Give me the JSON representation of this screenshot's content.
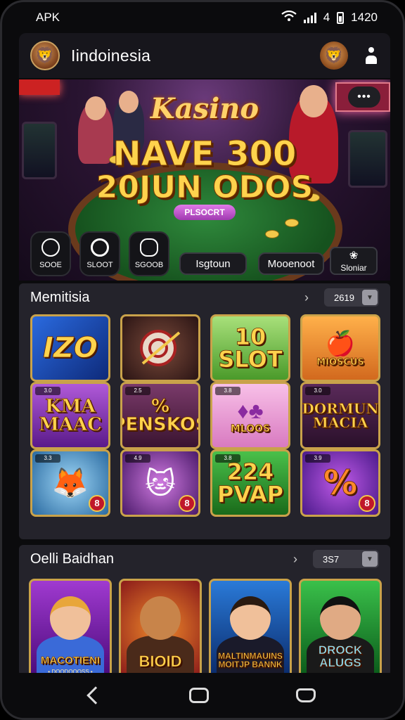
{
  "status_bar": {
    "carrier": "APK",
    "time": "1420",
    "network": "4"
  },
  "header": {
    "title": "Iindoinesia",
    "avatar_icon": "lion-avatar-icon",
    "mascot_icon": "lion-mascot-icon",
    "menu_icon": "user-icon"
  },
  "hero": {
    "brand": "Kasino",
    "line1": "NAVE 300",
    "line2": "20JUN ODOS",
    "pill": "PLSOCRT",
    "more_label": "•••",
    "quick_actions": [
      {
        "label": "SOOE",
        "icon": "person-circle-icon"
      },
      {
        "label": "SLOOT",
        "icon": "target-icon"
      },
      {
        "label": "SGOOB",
        "icon": "cloud-icon"
      }
    ],
    "buttons": [
      {
        "label": "Isgtoun"
      },
      {
        "label": "Mooenoot"
      }
    ],
    "promo": {
      "label": "Sloniar",
      "icon": "flower-icon"
    }
  },
  "section1": {
    "title": "Memitisia",
    "count": "2619",
    "tiles": [
      {
        "text": "IZO",
        "badge": "",
        "num": ""
      },
      {
        "text": "",
        "badge": "",
        "num": ""
      },
      {
        "text": "10\nSLOT",
        "badge": "",
        "num": ""
      },
      {
        "text": "MIOSCUS",
        "badge": "",
        "num": ""
      },
      {
        "text": "KMA\nMAAC",
        "badge": "3.0",
        "num": ""
      },
      {
        "text": "%\nPENSKOS",
        "badge": "2.5",
        "num": ""
      },
      {
        "text": "MLOOS",
        "badge": "3.8",
        "num": ""
      },
      {
        "text": "DORMUN\nMACIA",
        "badge": "3.0",
        "num": ""
      },
      {
        "text": "",
        "badge": "3.3",
        "num": "8"
      },
      {
        "text": "",
        "badge": "4.9",
        "num": "8"
      },
      {
        "text": "224\nPVAP",
        "badge": "3.8",
        "num": ""
      },
      {
        "text": "%",
        "badge": "3.9",
        "num": "8"
      }
    ]
  },
  "section2": {
    "title": "Oelli Baidhan",
    "count": "3S7",
    "cards": [
      {
        "name": "MACOTIENI",
        "sub": "• DOODOOOSS •"
      },
      {
        "name": "BIOID",
        "sub": ""
      },
      {
        "name": "MALTINMAUINS\nMOITJP BANNK",
        "sub": ""
      },
      {
        "name": "DROCK\nALUGS",
        "sub": ""
      }
    ]
  },
  "colors": {
    "gold": "#ffd34d",
    "frame": "#c9a24a",
    "table_green": "#2f8a3c",
    "panel": "#24232b"
  }
}
